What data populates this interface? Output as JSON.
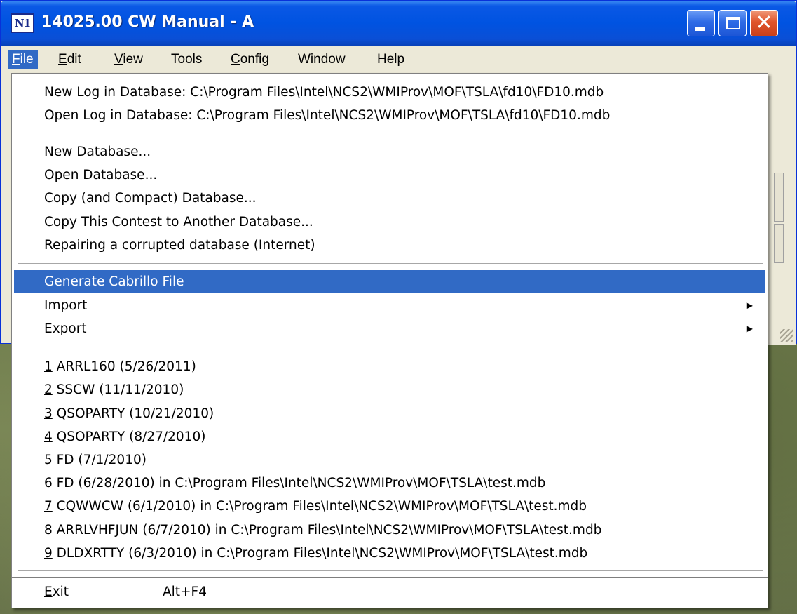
{
  "window": {
    "title": "14025.00 CW Manual - A",
    "icon_text": "N1",
    "minimize": "minimize",
    "maximize": "maximize",
    "close": "close",
    "close_glyph": "✕"
  },
  "menubar": {
    "items": [
      {
        "label": "File",
        "accel": "F",
        "rest": "ile"
      },
      {
        "label": "Edit",
        "accel": "E",
        "rest": "dit"
      },
      {
        "label": "View",
        "accel": "V",
        "rest": "iew"
      },
      {
        "label": "Tools",
        "accel": "",
        "rest": "Tools"
      },
      {
        "label": "Config",
        "accel": "C",
        "rest": "onfig"
      },
      {
        "label": "Window",
        "accel": "",
        "rest": "Window"
      },
      {
        "label": "Help",
        "accel": "",
        "rest": "Help"
      }
    ],
    "active": "File"
  },
  "file_menu": {
    "new_log": "New Log in Database: C:\\Program Files\\Intel\\NCS2\\WMIProv\\MOF\\TSLA\\fd10\\FD10.mdb",
    "open_log": "Open Log in Database: C:\\Program Files\\Intel\\NCS2\\WMIProv\\MOF\\TSLA\\fd10\\FD10.mdb",
    "new_database": "New Database...",
    "open_database": {
      "accel": "O",
      "rest": "pen Database..."
    },
    "copy_compact": "Copy (and Compact) Database...",
    "copy_contest": "Copy This Contest to Another Database...",
    "repairing": "Repairing a corrupted database (Internet)",
    "generate_cabrillo": "Generate Cabrillo File",
    "import": "Import",
    "export": "Export",
    "recent": [
      {
        "num": "1",
        "text": " ARRL160 (5/26/2011)"
      },
      {
        "num": "2",
        "text": " SSCW (11/11/2010)"
      },
      {
        "num": "3",
        "text": " QSOPARTY (10/21/2010)"
      },
      {
        "num": "4",
        "text": " QSOPARTY (8/27/2010)"
      },
      {
        "num": "5",
        "text": " FD (7/1/2010)"
      },
      {
        "num": "6",
        "text": " FD (6/28/2010) in C:\\Program Files\\Intel\\NCS2\\WMIProv\\MOF\\TSLA\\test.mdb"
      },
      {
        "num": "7",
        "text": " CQWWCW (6/1/2010) in C:\\Program Files\\Intel\\NCS2\\WMIProv\\MOF\\TSLA\\test.mdb"
      },
      {
        "num": "8",
        "text": " ARRLVHFJUN (6/7/2010) in C:\\Program Files\\Intel\\NCS2\\WMIProv\\MOF\\TSLA\\test.mdb"
      },
      {
        "num": "9",
        "text": " DLDXRTTY (6/3/2010) in C:\\Program Files\\Intel\\NCS2\\WMIProv\\MOF\\TSLA\\test.mdb"
      }
    ],
    "exit": {
      "accel": "E",
      "rest": "xit",
      "shortcut": "Alt+F4"
    },
    "submenu_arrow": "▶"
  },
  "colors": {
    "highlight": "#316ac5",
    "titlebar": "#0053e1",
    "menu_bg": "#ece9d8"
  }
}
